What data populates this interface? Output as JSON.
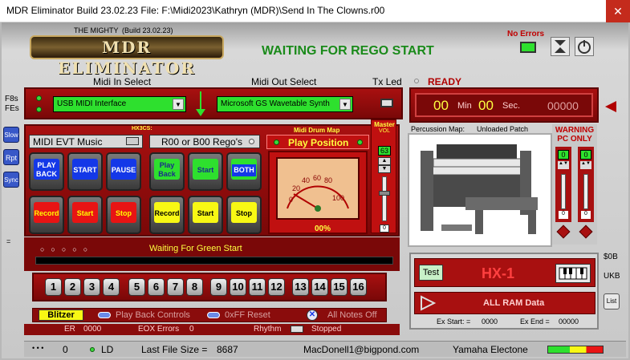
{
  "window": {
    "title": "MDR Eliminator Build 23.02.23   File:  F:\\Midi2023\\Kathryn (MDR)\\Send In The Clowns.r00",
    "close": "✕"
  },
  "header": {
    "the_mighty": "THE MIGHTY",
    "build": "(Build 23.02.23)",
    "logo": "MDR ELIMINATOR",
    "status": "WAITING FOR REGO START",
    "no_errors": "No Errors"
  },
  "left_side": {
    "f8s": "F8s",
    "fes": "FEs",
    "slow": "Slow",
    "rpt": "Rpt",
    "sync": "Sync",
    "eq": "="
  },
  "midi": {
    "in_label": "Midi In Select",
    "out_label": "Midi Out Select",
    "tx_led": "Tx Led",
    "in_value": "USB MIDI Interface",
    "out_value": "Microsoft GS Wavetable Synth",
    "ready": "READY"
  },
  "timer": {
    "min_value": "00",
    "min_label": "Min",
    "sec_value": "00",
    "sec_label": "Sec.",
    "counter": "00000"
  },
  "pads": {
    "hx3cs": "HX3CS:",
    "evt_label": "MIDI EVT Music",
    "rego_label": "R00 or B00 Rego's",
    "drum_map": "Midi Drum Map",
    "play_position": "Play Position",
    "master": "Master",
    "vol": "VOL",
    "vol_value": "63",
    "vol_low": "0",
    "left_top": [
      "PLAY BACK",
      "START",
      "PAUSE"
    ],
    "left_bottom": [
      "Record",
      "Start",
      "Stop"
    ],
    "right_top": [
      "Play Back",
      "Start",
      "BOTH"
    ],
    "right_bottom": [
      "Record",
      "Start",
      "Stop"
    ],
    "gauge_ticks": [
      "0",
      "20",
      "40",
      "60",
      "80",
      "100"
    ],
    "gauge_percent": "00%",
    "waiting_green": "Waiting For Green Start"
  },
  "channels": [
    "1",
    "2",
    "3",
    "4",
    "5",
    "6",
    "7",
    "8",
    "9",
    "10",
    "11",
    "12",
    "13",
    "14",
    "15",
    "16"
  ],
  "bottom_bar": {
    "blitzer": "Blitzer",
    "playback_controls": "Play Back Controls",
    "reset": "0xFF Reset",
    "all_notes_off": "All Notes Off",
    "er_label": "ER",
    "er_value": "0000",
    "eox_label": "EOX Errors",
    "eox_value": "0",
    "rhythm": "Rhythm",
    "stopped": "Stopped"
  },
  "percussion": {
    "map_label": "Percussion Map:",
    "map_value": "Unloaded Patch"
  },
  "warning": {
    "line1": "WARNING",
    "line2": "PC ONLY",
    "left_value": "0",
    "right_value": "0",
    "left_low": "0",
    "right_low": "0"
  },
  "hx": {
    "test": "Test",
    "model": "HX-1",
    "ram": "ALL RAM Data",
    "ex_start_label": "Ex Start: =",
    "ex_start_value": "0000",
    "ex_end_label": "Ex End =",
    "ex_end_value": "00000"
  },
  "right_side": {
    "sob": "$0B",
    "ukb": "UKB",
    "list": "List"
  },
  "status": {
    "dots": "• • •",
    "count": "0",
    "ld": "LD",
    "last_file_label": "Last File Size =",
    "last_file_value": "8687",
    "email": "MacDonell1@bigpond.com",
    "device": "Yamaha Electone"
  },
  "colors": {
    "accent_red": "#a81010",
    "green": "#2ee02e",
    "title_green": "#1a8a1a",
    "ready_red": "#b00000"
  }
}
